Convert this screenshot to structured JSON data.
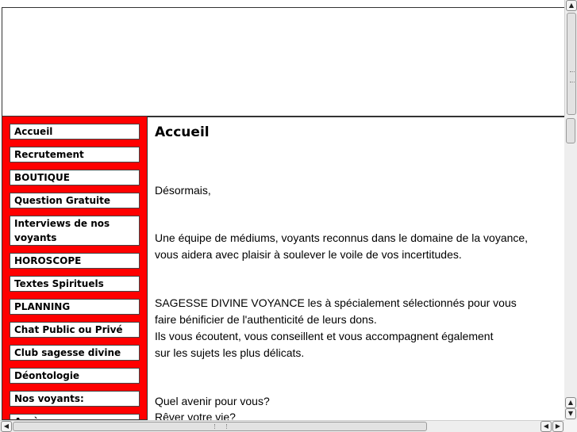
{
  "sidebar": {
    "items": [
      {
        "label": "Accueil"
      },
      {
        "label": "Recrutement"
      },
      {
        "label": "BOUTIQUE"
      },
      {
        "label": "Question Gratuite"
      },
      {
        "label": "Interviews de nos voyants"
      },
      {
        "label": "HOROSCOPE"
      },
      {
        "label": "Textes Spirituels"
      },
      {
        "label": "PLANNING"
      },
      {
        "label": "Chat Public ou Privé"
      },
      {
        "label": "Club sagesse divine"
      },
      {
        "label": "Déontologie"
      },
      {
        "label": "Nos voyants:"
      },
      {
        "label": "Accès..."
      }
    ]
  },
  "content": {
    "title": "Accueil",
    "p1": "Désormais,",
    "p2_l1": "Une équipe de médiums, voyants reconnus dans le domaine de la voyance,",
    "p2_l2": "vous aidera avec plaisir à soulever le voile de vos incertitudes.",
    "p3_l1": "SAGESSE DIVINE VOYANCE les à spécialement sélectionnés pour vous",
    "p3_l2": "faire bénificier de l'authenticité de leurs dons.",
    "p3_l3": "Ils vous écoutent, vous conseillent et vous accompagnent également",
    "p3_l4": "sur les sujets les plus délicats.",
    "p4_l1": "Quel avenir pour vous?",
    "p4_l2": "Rêver votre vie?"
  },
  "colors": {
    "sidebar_bg": "#ff0000",
    "menu_item_bg": "#ffffff"
  },
  "icons": {
    "scroll_up": "arrow-up-icon",
    "scroll_down": "arrow-down-icon",
    "scroll_left": "arrow-left-icon",
    "scroll_right": "arrow-right-icon"
  }
}
